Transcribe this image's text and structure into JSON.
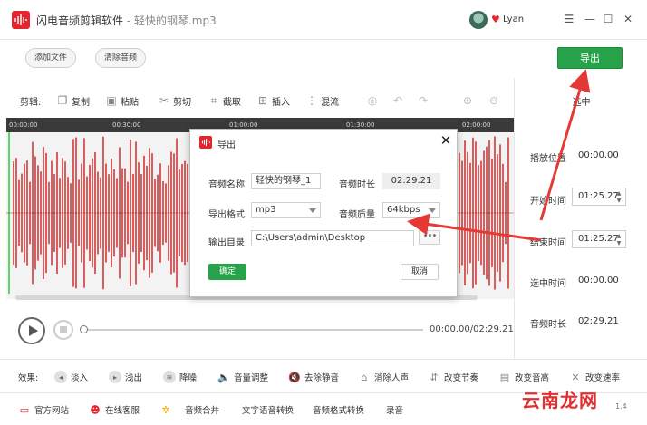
{
  "app": {
    "name": "闪电音频剪辑软件",
    "separator": " - ",
    "file_name": "轻快的钢琴.mp3",
    "user": "Lyan"
  },
  "colors": {
    "accent_green": "#25a24a",
    "brand_red": "#e3262e",
    "annotation_arrow": "#e53935"
  },
  "top_actions": {
    "add_file": "添加文件",
    "clear_audio": "清除音频",
    "export": "导出"
  },
  "toolbar": {
    "label": "剪辑:",
    "copy": "复制",
    "paste": "粘贴",
    "cut": "剪切",
    "crop": "截取",
    "insert": "插入",
    "mix": "混流"
  },
  "ruler": {
    "ticks": [
      "00:00:00",
      "00:30:00",
      "01:00:00",
      "01:30:00",
      "02:00:00"
    ]
  },
  "right_panel": {
    "title": "选中",
    "play_position_label": "播放位置",
    "play_position_value": "00:00.00",
    "start_time_label": "开始时间",
    "start_time_value": "01:25.27",
    "end_time_label": "结束时间",
    "end_time_value": "01:25.27",
    "selected_time_label": "选中时间",
    "selected_time_value": "00:00.00",
    "audio_duration_label": "音频时长",
    "audio_duration_value": "02:29.21"
  },
  "player": {
    "time": "00:00.00/02:29.21"
  },
  "effects": {
    "label": "效果:",
    "items": [
      "淡入",
      "浅出",
      "降噪",
      "音量调整",
      "去除静音",
      "消除人声",
      "改变节奏",
      "改变音高",
      "改变速率"
    ]
  },
  "bottom": {
    "items": [
      "官方网站",
      "在线客服",
      "音频合并",
      "文字语音转换",
      "音频格式转换",
      "录音"
    ],
    "watermark": "云南龙网",
    "version": "1.4"
  },
  "dialog": {
    "title": "导出",
    "name_label": "音频名称",
    "name_value": "轻快的钢琴_1",
    "duration_label": "音频时长",
    "duration_value": "02:29.21",
    "format_label": "导出格式",
    "format_value": "mp3",
    "quality_label": "音频质量",
    "quality_value": "64kbps",
    "output_label": "输出目录",
    "output_value": "C:\\Users\\admin\\Desktop",
    "more": "•••",
    "ok": "确定",
    "cancel": "取消"
  }
}
